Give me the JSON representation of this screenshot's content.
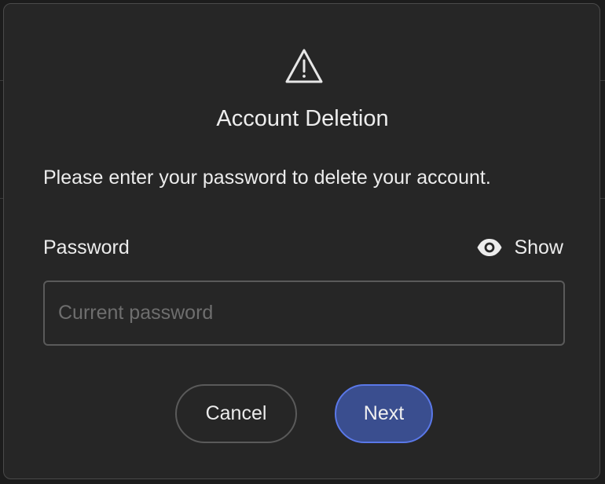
{
  "dialog": {
    "icon": "warning-triangle-icon",
    "title": "Account Deletion",
    "message": "Please enter your password to delete your account.",
    "password_label": "Password",
    "show_toggle": {
      "icon": "eye-icon",
      "label": "Show"
    },
    "password_input": {
      "value": "",
      "placeholder": "Current password"
    },
    "buttons": {
      "cancel_label": "Cancel",
      "next_label": "Next"
    }
  },
  "colors": {
    "accent": "#3a4e8f",
    "accent_border": "#5a78e8",
    "dialog_bg": "#262626",
    "text": "#ececec"
  }
}
